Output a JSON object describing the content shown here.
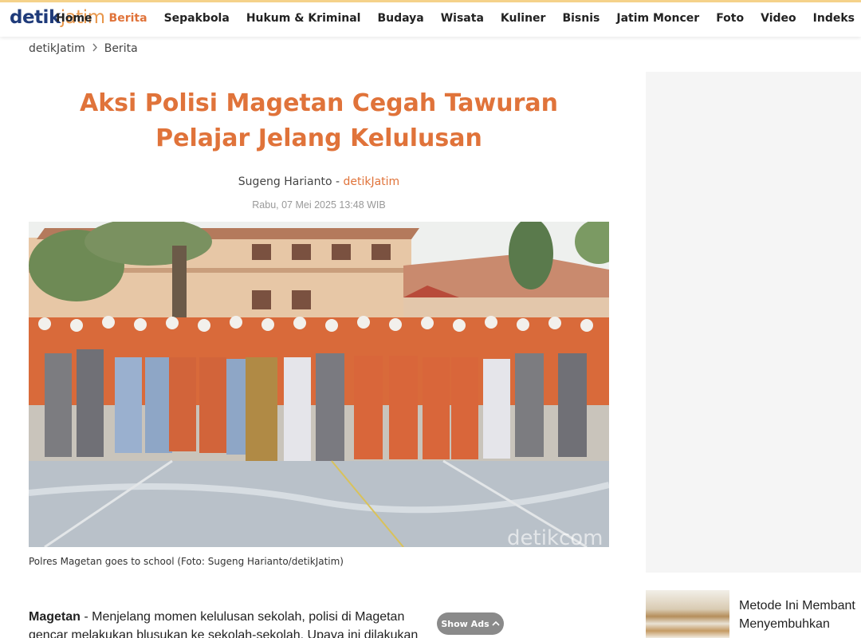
{
  "header": {
    "logo_primary": "detik",
    "logo_secondary": "jatim",
    "nav": [
      {
        "label": "Home",
        "active": false
      },
      {
        "label": "Berita",
        "active": true
      },
      {
        "label": "Sepakbola",
        "active": false
      },
      {
        "label": "Hukum & Kriminal",
        "active": false
      },
      {
        "label": "Budaya",
        "active": false
      },
      {
        "label": "Wisata",
        "active": false
      },
      {
        "label": "Kuliner",
        "active": false
      },
      {
        "label": "Bisnis",
        "active": false
      },
      {
        "label": "Jatim Moncer",
        "active": false
      },
      {
        "label": "Foto",
        "active": false
      },
      {
        "label": "Video",
        "active": false
      },
      {
        "label": "Indeks",
        "active": false
      }
    ]
  },
  "breadcrumb": {
    "items": [
      "detikJatim",
      "Berita"
    ],
    "separator_icon": "chevron-right-icon"
  },
  "article": {
    "title": "Aksi Polisi Magetan Cegah Tawuran Pelajar Jelang Kelulusan",
    "author": "Sugeng Harianto",
    "author_sep": " - ",
    "source": "detikJatim",
    "date": "Rabu, 07 Mei 2025 13:48 WIB",
    "photo_watermark": "detikcom",
    "caption": "Polres Magetan goes to school (Foto: Sugeng Harianto/detikJatim)",
    "lead_location": "Magetan",
    "lead_sep": " - ",
    "lead_text_1": "Menjelang momen kelulusan sekolah, polisi di Magetan",
    "lead_text_2": "gencar melakukan blusukan ke sekolah-sekolah. Upaya ini dilakukan"
  },
  "ads": {
    "show_ads_label": "Show Ads",
    "show_ads_icon": "chevron-up-icon"
  },
  "sidebar": {
    "promo_line_1": "Metode Ini Membant",
    "promo_line_2": "Menyembuhkan"
  },
  "colors": {
    "accent": "#e0733a",
    "logo_blue": "#1f3b7a",
    "logo_orange": "#e8964a"
  }
}
